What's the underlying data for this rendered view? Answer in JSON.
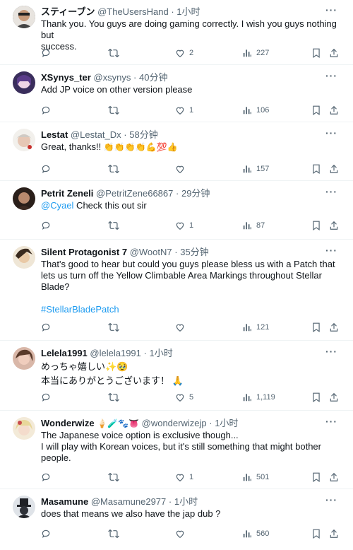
{
  "tweets": [
    {
      "name": "スティーブン",
      "handle": "@TheUsersHand",
      "dot": "·",
      "time": "1小时",
      "lines": [
        "Thank you. You guys are doing gaming correctly. I wish you guys nothing but",
        "success."
      ],
      "replies": "",
      "retweets": "",
      "likes": "2",
      "views": "227",
      "avatar_color": "#3b3b3b"
    },
    {
      "name": "XSynys_ter",
      "handle": "@xsynys",
      "dot": "·",
      "time": "40分钟",
      "lines": [
        "Add JP voice on other version please"
      ],
      "replies": "",
      "retweets": "",
      "likes": "1",
      "views": "106",
      "avatar_color": "#6a4c8c"
    },
    {
      "name": "Lestat",
      "handle": "@Lestat_Dx",
      "dot": "·",
      "time": "58分钟",
      "text": "Great, thanks!!",
      "emoji": "👏👏👏👏💪💯👍",
      "replies": "",
      "retweets": "",
      "likes": "",
      "views": "157",
      "avatar_color": "#d8d2cc"
    },
    {
      "name": "Petrit Zeneli",
      "handle": "@PetritZene66867",
      "dot": "·",
      "time": "29分钟",
      "mention": "@Cyael",
      "text": " Check this out sir",
      "replies": "",
      "retweets": "",
      "likes": "1",
      "views": "87",
      "avatar_color": "#5a3b2e"
    },
    {
      "name": "Silent Protagonist 7",
      "handle": "@WootN7",
      "dot": "·",
      "time": "35分钟",
      "lines": [
        "That's good to hear but could you guys please bless us with a Patch that",
        "lets us turn off the Yellow Climbable Area Markings throughout Stellar",
        "Blade?"
      ],
      "hashtag": "#StellarBladePatch",
      "replies": "",
      "retweets": "",
      "likes": "",
      "views": "121",
      "avatar_color": "#8c6a3a"
    },
    {
      "name": "Lelela1991",
      "handle": "@lelela1991",
      "dot": "·",
      "time": "1小时",
      "lines": [
        "めっちゃ嬉しい✨🥹",
        "本当にありがとうございます！ 🙏"
      ],
      "replies": "",
      "retweets": "",
      "likes": "5",
      "views": "1,119",
      "avatar_color": "#c49a8a"
    },
    {
      "name": "Wonderwize",
      "name_emoji": "🍦🧪🐾👅",
      "handle": "@wonderwizejp",
      "dot": "·",
      "time": "1小时",
      "lines": [
        "The Japanese voice option is exclusive though...",
        "I will play with Korean voices, but it's still something that might bother",
        "people."
      ],
      "replies": "",
      "retweets": "",
      "likes": "1",
      "views": "501",
      "avatar_color": "#e9dcc4"
    },
    {
      "name": "Masamune",
      "handle": "@Masamune2977",
      "dot": "·",
      "time": "1小时",
      "lines": [
        "does that means we also have the jap dub ?"
      ],
      "replies": "",
      "retweets": "",
      "likes": "",
      "views": "560",
      "avatar_color": "#2e3138"
    }
  ],
  "icons": {
    "more": "more-icon",
    "reply": "reply-icon",
    "retweet": "retweet-icon",
    "like": "heart-icon",
    "views": "views-icon",
    "bookmark": "bookmark-icon",
    "share": "share-icon"
  },
  "colors": {
    "link": "#1d9bf0",
    "muted": "#536471",
    "text": "#0f1419"
  },
  "more_label": "···"
}
